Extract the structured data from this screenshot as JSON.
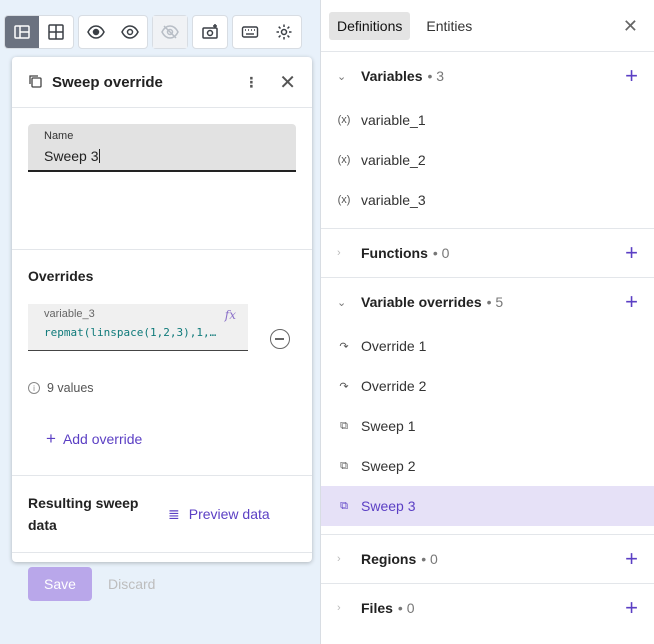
{
  "toolbar": {
    "groups": [
      [
        "layout-icon",
        "grid-icon"
      ],
      [
        "eye-icon",
        "eye-outline-icon"
      ],
      [
        "eye-disabled-icon"
      ],
      [
        "camera-add-icon"
      ],
      [
        "keyboard-icon",
        "gear-icon"
      ]
    ]
  },
  "panel": {
    "title": "Sweep override",
    "name_label": "Name",
    "name_value": "Sweep 3",
    "overrides_title": "Overrides",
    "override": {
      "variable": "variable_3",
      "expression": "repmat(linspace(1,2,3),1,…",
      "fx": "fx"
    },
    "values_count": "9 values",
    "add_override": "Add override",
    "resulting_label": "Resulting sweep data",
    "preview": "Preview data",
    "save": "Save",
    "discard": "Discard"
  },
  "right": {
    "tabs": [
      "Definitions",
      "Entities"
    ],
    "active_tab": "Definitions",
    "sections": {
      "variables": {
        "title": "Variables",
        "count": "• 3",
        "items": [
          "variable_1",
          "variable_2",
          "variable_3"
        ]
      },
      "functions": {
        "title": "Functions",
        "count": "• 0"
      },
      "variable_overrides": {
        "title": "Variable overrides",
        "count": "• 5",
        "items": [
          "Override 1",
          "Override 2",
          "Sweep 1",
          "Sweep 2",
          "Sweep 3"
        ],
        "selected": "Sweep 3"
      },
      "regions": {
        "title": "Regions",
        "count": "• 0"
      },
      "files": {
        "title": "Files",
        "count": "• 0"
      }
    }
  },
  "colors": {
    "accent": "#5b3fc4",
    "selected_bg": "#e6e1f7",
    "save_bg": "#b9a7ea",
    "page_bg": "#e8f1fa"
  }
}
